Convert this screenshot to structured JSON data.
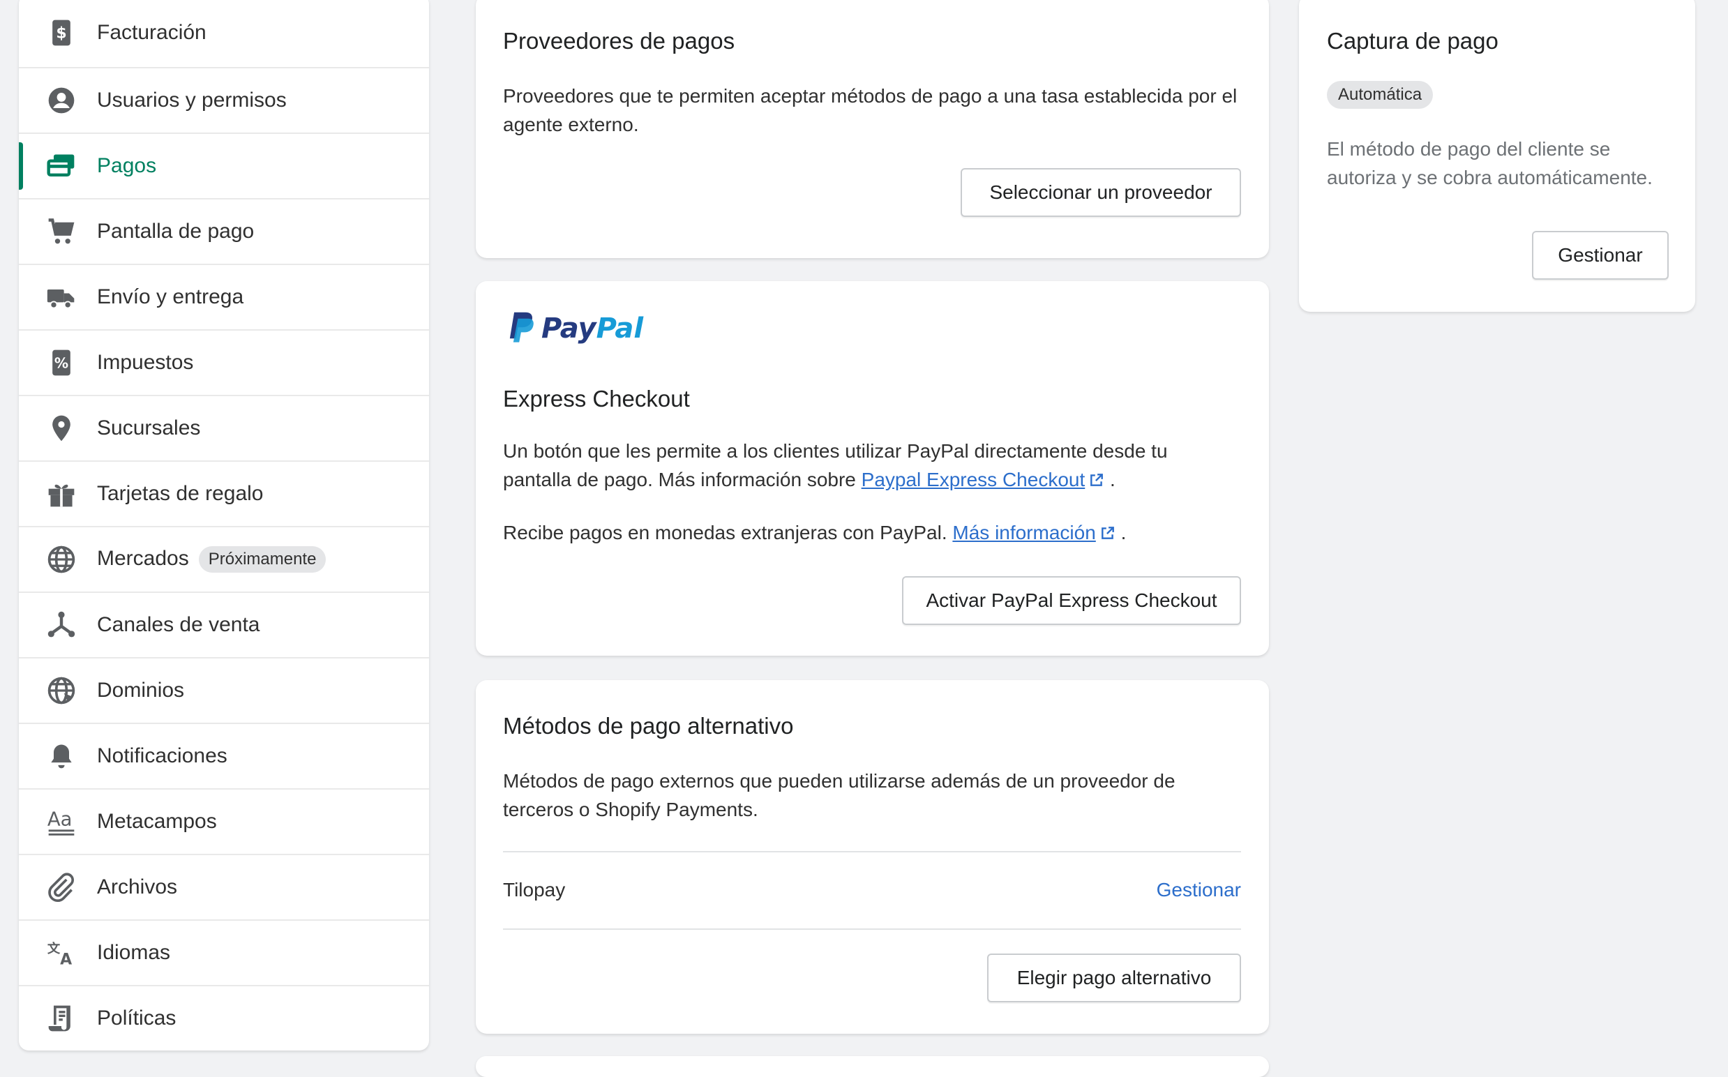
{
  "sidebar": {
    "active_color": "#008060",
    "items": [
      {
        "label": "Facturación",
        "icon": "billing-icon"
      },
      {
        "label": "Usuarios y permisos",
        "icon": "user-circle-icon"
      },
      {
        "label": "Pagos",
        "icon": "payments-icon",
        "active": true
      },
      {
        "label": "Pantalla de pago",
        "icon": "cart-icon"
      },
      {
        "label": "Envío y entrega",
        "icon": "truck-icon"
      },
      {
        "label": "Impuestos",
        "icon": "tax-icon"
      },
      {
        "label": "Sucursales",
        "icon": "location-pin-icon"
      },
      {
        "label": "Tarjetas de regalo",
        "icon": "gift-icon"
      },
      {
        "label": "Mercados",
        "icon": "globe-icon",
        "badge": "Próximamente"
      },
      {
        "label": "Canales de venta",
        "icon": "sales-channels-icon"
      },
      {
        "label": "Dominios",
        "icon": "domain-globe-icon"
      },
      {
        "label": "Notificaciones",
        "icon": "bell-icon"
      },
      {
        "label": "Metacampos",
        "icon": "metafields-icon"
      },
      {
        "label": "Archivos",
        "icon": "paperclip-icon"
      },
      {
        "label": "Idiomas",
        "icon": "translate-icon"
      },
      {
        "label": "Políticas",
        "icon": "policy-icon"
      }
    ]
  },
  "providers": {
    "title": "Proveedores de pagos",
    "description": "Proveedores que te permiten aceptar métodos de pago a una tasa establecida por el agente externo.",
    "button": "Seleccionar un proveedor"
  },
  "paypal": {
    "logo_text": "PayPal",
    "logo_colors": {
      "pay": "#253b80",
      "pal": "#179bd7"
    },
    "title": "Express Checkout",
    "desc1_text": "Un botón que les permite a los clientes utilizar PayPal directamente desde tu pantalla de pago. Más información sobre ",
    "desc1_link": "Paypal Express Checkout",
    "desc2_text": "Recibe pagos en monedas extranjeras con PayPal. ",
    "desc2_link": "Más información",
    "period": ".",
    "button": "Activar PayPal Express Checkout"
  },
  "alternative": {
    "title": "Métodos de pago alternativo",
    "description": "Métodos de pago externos que pueden utilizarse además de un proveedor de terceros o Shopify Payments.",
    "provider_name": "Tilopay",
    "manage_link": "Gestionar",
    "button": "Elegir pago alternativo"
  },
  "capture": {
    "title": "Captura de pago",
    "badge": "Automática",
    "description": "El método de pago del cliente se autoriza y se cobra automáticamente.",
    "button": "Gestionar"
  }
}
